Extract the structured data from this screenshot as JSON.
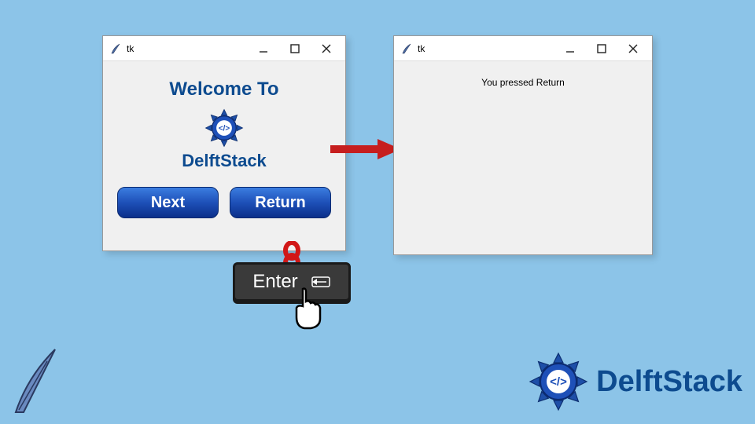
{
  "window_left": {
    "title": "tk",
    "heading": "Welcome To",
    "brand": "DelftStack",
    "buttons": {
      "next": "Next",
      "return": "Return"
    }
  },
  "window_right": {
    "title": "tk",
    "message": "You pressed Return"
  },
  "enter_key": {
    "label": "Enter"
  },
  "branding": {
    "corner_text": "DelftStack"
  },
  "colors": {
    "brand_blue": "#0d4b8f",
    "arrow_red": "#c61e1e",
    "link_red": "#d11717"
  }
}
